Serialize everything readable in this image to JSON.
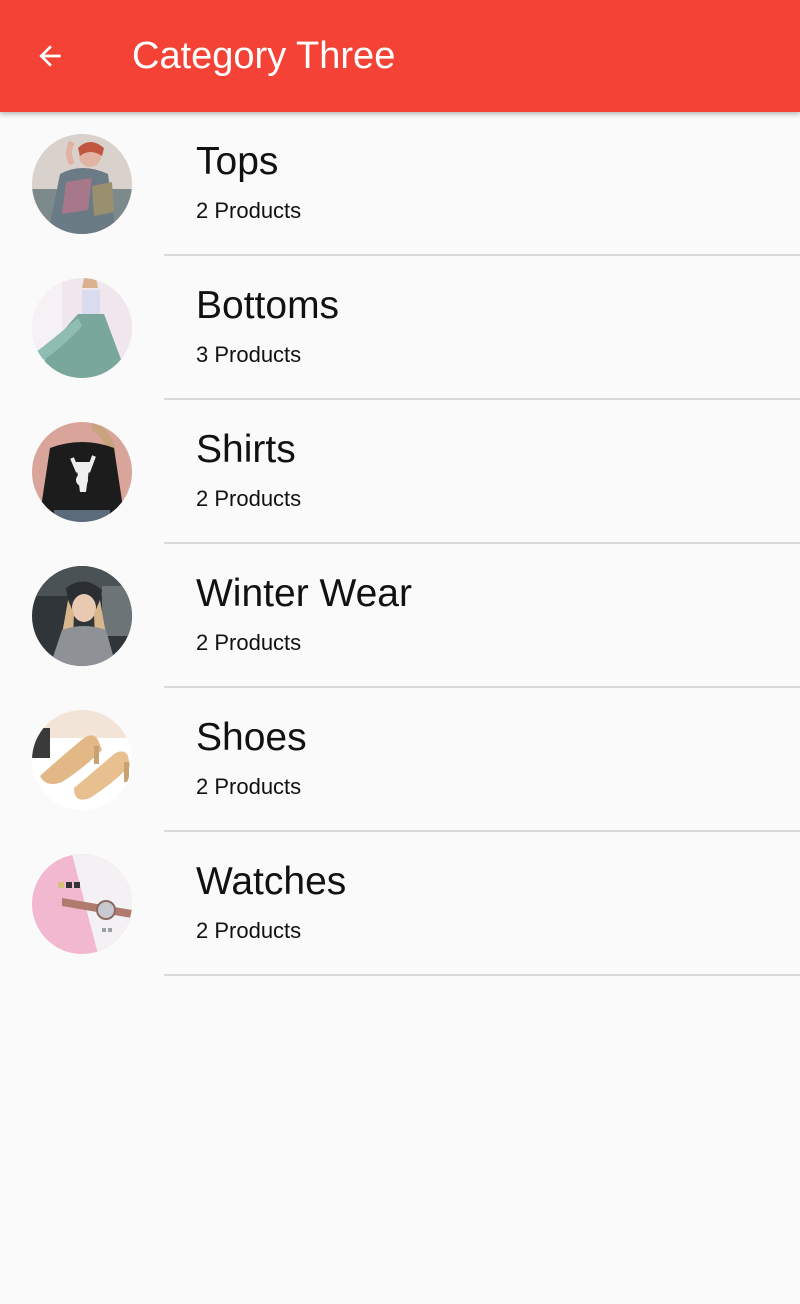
{
  "app_bar": {
    "title": "Category Three",
    "back_icon": "arrow-back-icon",
    "color": "#f44336"
  },
  "categories": [
    {
      "name": "Tops",
      "count_label": "2 Products",
      "image": "tops-photo"
    },
    {
      "name": "Bottoms",
      "count_label": "3 Products",
      "image": "bottoms-photo"
    },
    {
      "name": "Shirts",
      "count_label": "2 Products",
      "image": "shirts-photo"
    },
    {
      "name": "Winter Wear",
      "count_label": "2 Products",
      "image": "winter-wear-photo"
    },
    {
      "name": "Shoes",
      "count_label": "2 Products",
      "image": "shoes-photo"
    },
    {
      "name": "Watches",
      "count_label": "2 Products",
      "image": "watches-photo"
    }
  ]
}
